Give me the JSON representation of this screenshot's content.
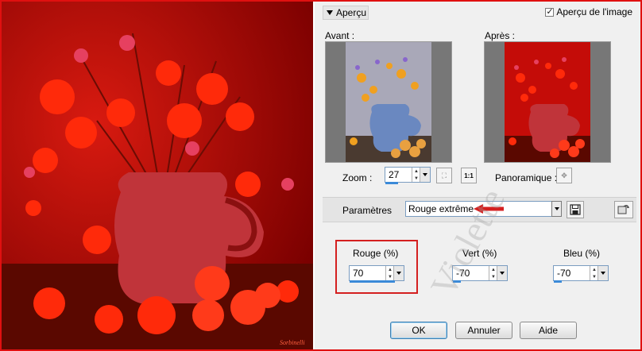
{
  "dialog": {
    "section_header": "Aperçu",
    "preview_checkbox_label": "Aperçu de l'image",
    "preview_checked": true,
    "before_label": "Avant :",
    "after_label": "Après :",
    "zoom_label": "Zoom :",
    "zoom_value": "27",
    "zoom_level_percent": 27,
    "panoramique_label": "Panoramique :",
    "params_label": "Paramètres",
    "preset_value": "Rouge extrême",
    "red": {
      "label": "Rouge (%)",
      "value": "70"
    },
    "green": {
      "label": "Vert (%)",
      "value": "-70"
    },
    "blue": {
      "label": "Bleu (%)",
      "value": "-70"
    },
    "buttons": {
      "ok": "OK",
      "cancel": "Annuler",
      "help": "Aide"
    }
  },
  "watermark_text": "Violette",
  "signature_text": "Sorbinelli",
  "colors": {
    "accent_red": "#d42020",
    "tint_red": "#c40000",
    "progress_blue": "#3b8ad8"
  }
}
